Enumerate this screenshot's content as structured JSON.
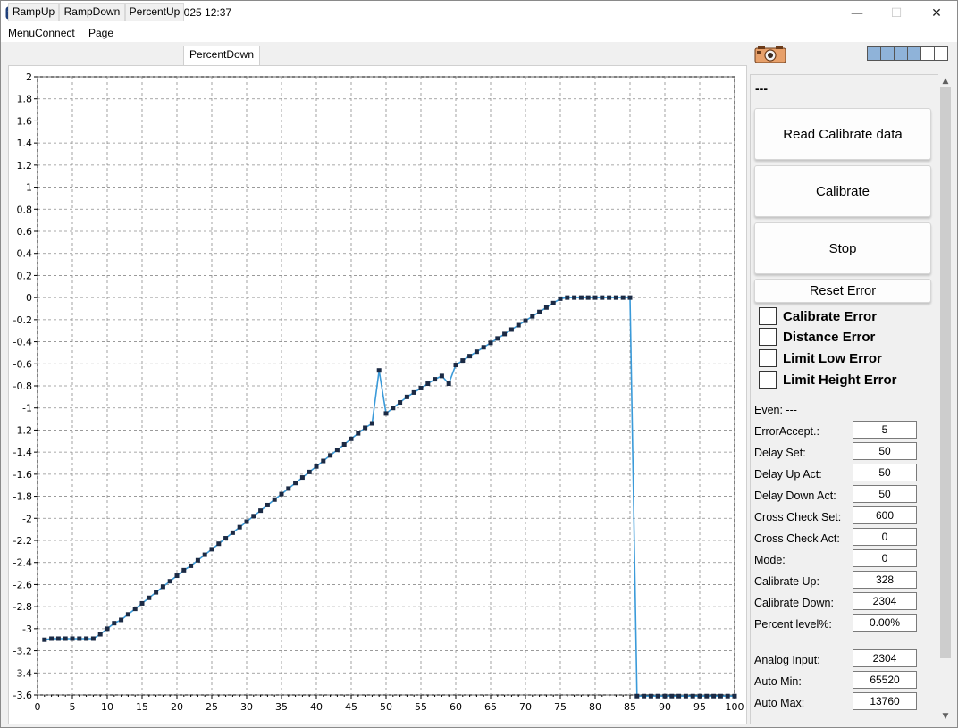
{
  "window": {
    "title": "Actuator Valve Tester V1.0 23/6/2025 12:37",
    "minimize_glyph": "—",
    "maximize_glyph": "☐",
    "close_glyph": "✕"
  },
  "menu": [
    "MenuConnect",
    "Page"
  ],
  "tabs": [
    {
      "label": "RampUp",
      "active": false
    },
    {
      "label": "RampDown",
      "active": false
    },
    {
      "label": "PercentUp",
      "active": false
    },
    {
      "label": "PercentDown",
      "active": true
    }
  ],
  "icons": {
    "app": "paw-icon",
    "camera": "camera-icon"
  },
  "colors": {
    "line": "#3a9ad9",
    "marker": "#1b2a44",
    "grid": "#8c8c8c",
    "indicator": "#8fb3d9"
  },
  "indicators": {
    "filled": 4,
    "empty": 2
  },
  "panel": {
    "status": "---",
    "buttons": {
      "read": "Read Calibrate data",
      "calibrate": "Calibrate",
      "stop": "Stop",
      "reset": "Reset Error"
    },
    "checkboxes": [
      "Calibrate Error",
      "Distance Error",
      "Limit Low Error",
      "Limit Height Error"
    ],
    "even_label": "Even: ---",
    "fields": [
      {
        "label": "ErrorAccept.:",
        "value": "5"
      },
      {
        "label": "Delay Set:",
        "value": "50"
      },
      {
        "label": "Delay Up Act:",
        "value": "50"
      },
      {
        "label": "Delay Down Act:",
        "value": "50"
      },
      {
        "label": "Cross Check Set:",
        "value": "600"
      },
      {
        "label": "Cross Check Act:",
        "value": "0"
      },
      {
        "label": "Mode:",
        "value": "0"
      },
      {
        "label": "Calibrate Up:",
        "value": "328"
      },
      {
        "label": "Calibrate Down:",
        "value": "2304"
      },
      {
        "label": "Percent level%:",
        "value": "0.00%"
      },
      {
        "label": "Analog Input:",
        "value": "2304"
      },
      {
        "label": "Auto Min:",
        "value": "65520"
      },
      {
        "label": "Auto Max:",
        "value": "13760"
      }
    ]
  },
  "chart_data": {
    "type": "line",
    "xlim": [
      0,
      100
    ],
    "ylim": [
      -3.6,
      2
    ],
    "x_ticks": [
      0,
      5,
      10,
      15,
      20,
      25,
      30,
      35,
      40,
      45,
      50,
      55,
      60,
      65,
      70,
      75,
      80,
      85,
      90,
      95,
      100
    ],
    "y_ticks": [
      "2",
      "1.8",
      "1.6",
      "1.4",
      "1.2",
      "1",
      "0.8",
      "0.6",
      "0.4",
      "0.2",
      "0",
      "-0.2",
      "-0.4",
      "-0.6",
      "-0.8",
      "-1",
      "-1.2",
      "-1.4",
      "-1.6",
      "-1.8",
      "-2",
      "-2.2",
      "-2.4",
      "-2.6",
      "-2.8",
      "-3",
      "-3.2",
      "-3.4",
      "-3.6"
    ],
    "grid": true,
    "series": [
      {
        "x": [
          1,
          2,
          3,
          4,
          5,
          6,
          7,
          8,
          9,
          10,
          11,
          12,
          13,
          14,
          15,
          16,
          17,
          18,
          19,
          20,
          21,
          22,
          23,
          24,
          25,
          26,
          27,
          28,
          29,
          30,
          31,
          32,
          33,
          34,
          35,
          36,
          37,
          38,
          39,
          40,
          41,
          42,
          43,
          44,
          45,
          46,
          47,
          48,
          49,
          50,
          51,
          52,
          53,
          54,
          55,
          56,
          57,
          58,
          59,
          60,
          61,
          62,
          63,
          64,
          65,
          66,
          67,
          68,
          69,
          70,
          71,
          72,
          73,
          74,
          75,
          76,
          77,
          78,
          79,
          80,
          81,
          82,
          83,
          84,
          85,
          86,
          87,
          88,
          89,
          90,
          91,
          92,
          93,
          94,
          95,
          96,
          97,
          98,
          99,
          100
        ],
        "y": [
          -3.1,
          -3.09,
          -3.09,
          -3.09,
          -3.09,
          -3.09,
          -3.09,
          -3.09,
          -3.05,
          -3.0,
          -2.95,
          -2.92,
          -2.87,
          -2.82,
          -2.77,
          -2.72,
          -2.67,
          -2.62,
          -2.57,
          -2.52,
          -2.47,
          -2.43,
          -2.38,
          -2.33,
          -2.28,
          -2.23,
          -2.18,
          -2.13,
          -2.08,
          -2.03,
          -1.98,
          -1.93,
          -1.88,
          -1.83,
          -1.78,
          -1.73,
          -1.68,
          -1.63,
          -1.58,
          -1.53,
          -1.48,
          -1.43,
          -1.38,
          -1.33,
          -1.28,
          -1.23,
          -1.18,
          -1.14,
          -0.66,
          -1.05,
          -1.0,
          -0.95,
          -0.9,
          -0.86,
          -0.82,
          -0.78,
          -0.74,
          -0.71,
          -0.78,
          -0.61,
          -0.57,
          -0.53,
          -0.49,
          -0.45,
          -0.41,
          -0.37,
          -0.33,
          -0.29,
          -0.25,
          -0.21,
          -0.17,
          -0.13,
          -0.09,
          -0.05,
          -0.01,
          0.0,
          0.0,
          0.0,
          0.0,
          0.0,
          0.0,
          0.0,
          0.0,
          0.0,
          0.0,
          -3.61,
          -3.61,
          -3.61,
          -3.61,
          -3.61,
          -3.61,
          -3.61,
          -3.61,
          -3.61,
          -3.61,
          -3.61,
          -3.61,
          -3.61,
          -3.61,
          -3.61
        ]
      }
    ]
  }
}
